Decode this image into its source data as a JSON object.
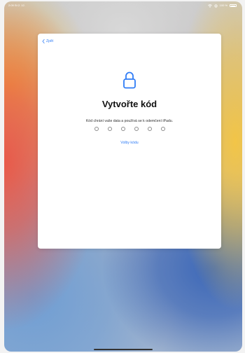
{
  "status_bar": {
    "time": "2:09",
    "date": "St 2. 12.",
    "battery": "100 %"
  },
  "navigation": {
    "back_label": "Zpět"
  },
  "passcode_screen": {
    "icon": "lock-icon",
    "title": "Vytvořte kód",
    "subtitle": "Kód chrání vaše data a používá se k odemčení iPadu.",
    "digit_count": 6,
    "options_label": "Volby kódu"
  },
  "colors": {
    "accent": "#2f7cf6",
    "card_background": "#ffffff"
  }
}
